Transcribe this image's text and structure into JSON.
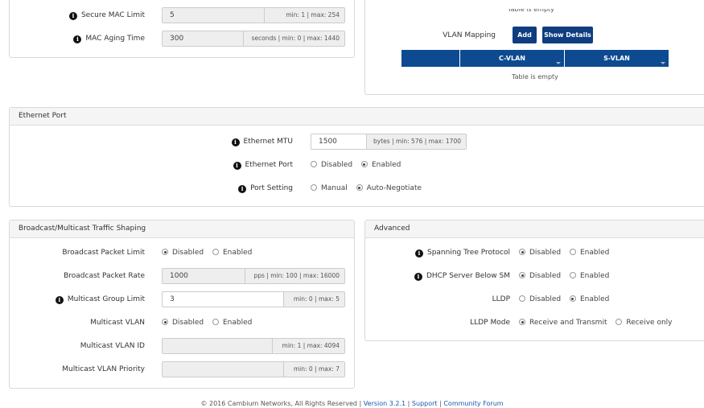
{
  "mac": {
    "secure_limit": {
      "label": "Secure MAC Limit",
      "value": "5",
      "hint": "min: 1 | max: 254"
    },
    "aging_time": {
      "label": "MAC Aging Time",
      "value": "300",
      "hint": "seconds | min: 0 | max: 1440"
    }
  },
  "vlan_map": {
    "top_empty": "Table is empty",
    "label": "VLAN Mapping",
    "add_button": "Add",
    "details_button": "Show Details",
    "columns": [
      "",
      "C-VLAN",
      "S-VLAN"
    ],
    "empty": "Table is empty"
  },
  "ethernet": {
    "title": "Ethernet Port",
    "mtu": {
      "label": "Ethernet MTU",
      "value": "1500",
      "hint": "bytes | min: 576 | max: 1700"
    },
    "port": {
      "label": "Ethernet Port",
      "options": [
        "Disabled",
        "Enabled"
      ],
      "selected": "Enabled"
    },
    "setting": {
      "label": "Port Setting",
      "options": [
        "Manual",
        "Auto-Negotiate"
      ],
      "selected": "Auto-Negotiate"
    }
  },
  "broadcast": {
    "title": "Broadcast/Multicast Traffic Shaping",
    "packet_limit": {
      "label": "Broadcast Packet Limit",
      "options": [
        "Disabled",
        "Enabled"
      ],
      "selected": "Disabled"
    },
    "packet_rate": {
      "label": "Broadcast Packet Rate",
      "value": "1000",
      "hint": "pps | min: 100 | max: 16000"
    },
    "group_limit": {
      "label": "Multicast Group Limit",
      "value": "3",
      "hint": "min: 0 | max: 5"
    },
    "mvlan": {
      "label": "Multicast VLAN",
      "options": [
        "Disabled",
        "Enabled"
      ],
      "selected": "Disabled"
    },
    "mvlan_id": {
      "label": "Multicast VLAN ID",
      "value": "",
      "hint": "min: 1 | max: 4094"
    },
    "mvlan_priority": {
      "label": "Multicast VLAN Priority",
      "value": "",
      "hint": "min: 0 | max: 7"
    }
  },
  "advanced": {
    "title": "Advanced",
    "stp": {
      "label": "Spanning Tree Protocol",
      "options": [
        "Disabled",
        "Enabled"
      ],
      "selected": "Disabled"
    },
    "dhcp": {
      "label": "DHCP Server Below SM",
      "options": [
        "Disabled",
        "Enabled"
      ],
      "selected": "Disabled"
    },
    "lldp": {
      "label": "LLDP",
      "options": [
        "Disabled",
        "Enabled"
      ],
      "selected": "Enabled"
    },
    "lldp_mode": {
      "label": "LLDP Mode",
      "options": [
        "Receive and Transmit",
        "Receive only"
      ],
      "selected": "Receive and Transmit"
    }
  },
  "footer": {
    "copyright": "© 2016 Cambium Networks, All Rights Reserved |",
    "version": "Version 3.2.1",
    "sep": "|",
    "support": "Support",
    "community": "Community Forum"
  }
}
